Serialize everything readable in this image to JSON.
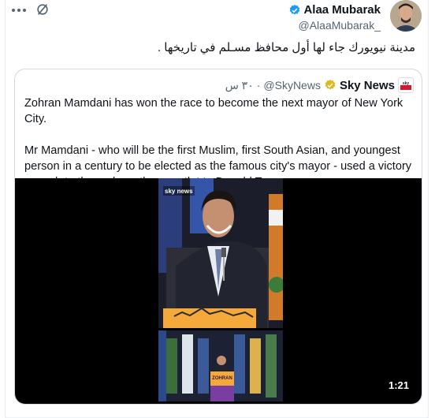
{
  "tweet": {
    "author_name": "Alaa Mubarak",
    "author_handle": "@AlaaMubarak_",
    "text": "مدينة نيويورك جاء لها أول محافظ مسـلم في تاريخها ."
  },
  "icons": {
    "more": "more-horizontal-icon",
    "grok": "grok-icon",
    "verified": "verified-blue-icon",
    "gold": "verified-gold-icon"
  },
  "quote": {
    "source_name": "Sky News",
    "source_handle": "@SkyNews",
    "separator": "·",
    "time": "٣٠ س",
    "paragraph1": "Zohran Mamdani has won the race to become the next mayor of New York City.",
    "paragraph2": "Mr Mamdani - who will be the first Muslim, first South Asian, and youngest person in a century to be elected as the famous city's mayor - used a victory speech to throw down the gauntlet to Donald Trump.",
    "video_logo": "sky news",
    "podium_text": "ZOHRAN",
    "duration": "1:21"
  },
  "colors": {
    "accent": "#1d9bf0",
    "gold": "#e2b719",
    "sky_red": "#d5172c"
  }
}
